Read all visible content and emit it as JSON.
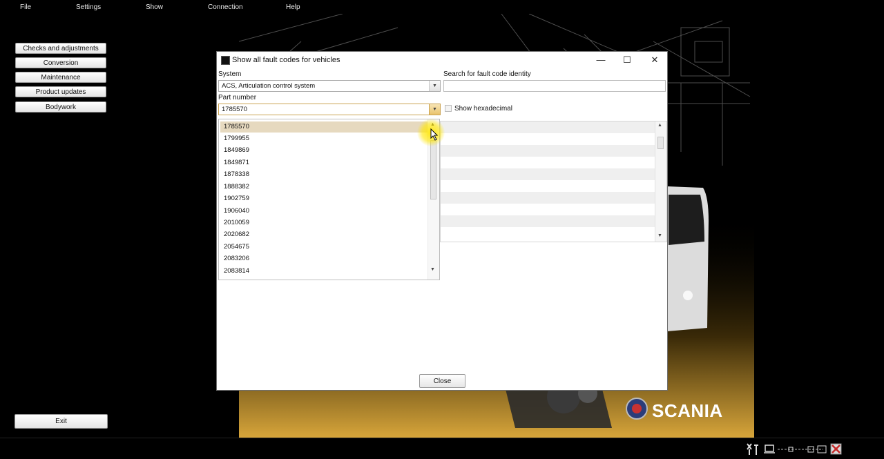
{
  "menu": [
    "File",
    "Settings",
    "Show",
    "Connection",
    "Help"
  ],
  "sidebar": {
    "buttons": [
      "Checks and adjustments",
      "Conversion",
      "Maintenance",
      "Product updates",
      "Bodywork"
    ],
    "exit_label": "Exit"
  },
  "brand": {
    "wordmark": "SCANIA",
    "accent": "#d7a53a"
  },
  "dialog": {
    "title": "Show all fault codes for vehicles",
    "system_label": "System",
    "system_value": "ACS, Articulation control system",
    "search_label": "Search for fault code identity",
    "search_value": "",
    "part_label": "Part number",
    "part_value": "1785570",
    "hex_label": "Show hexadecimal",
    "hex_checked": false,
    "close_label": "Close",
    "part_options": [
      "1785570",
      "1799955",
      "1849869",
      "1849871",
      "1878338",
      "1888382",
      "1902759",
      "1906040",
      "2010059",
      "2020682",
      "2054675",
      "2083206",
      "2083814"
    ],
    "selected_option": "1785570"
  }
}
